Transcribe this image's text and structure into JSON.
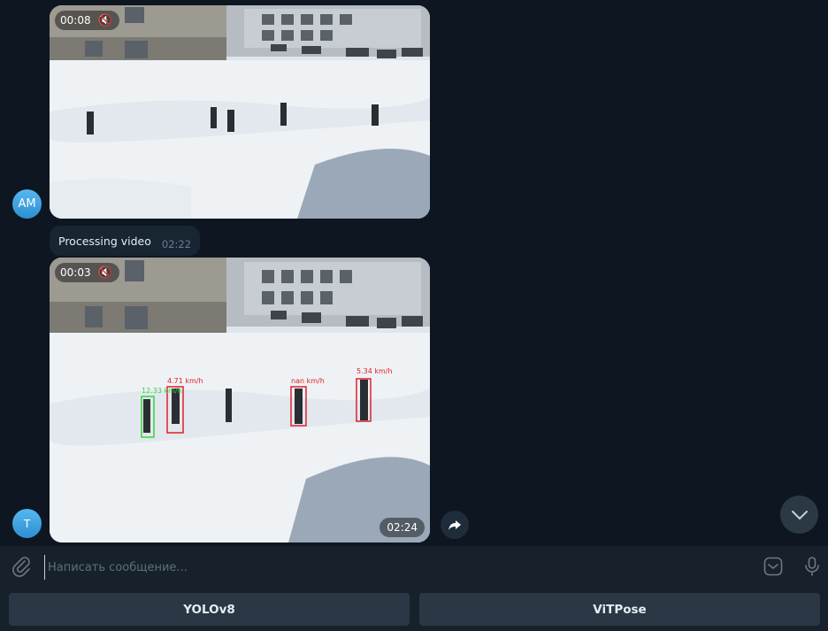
{
  "messages": [
    {
      "avatar": "AM",
      "video": {
        "duration": "00:08",
        "muted": true
      }
    },
    {
      "text": "Processing video",
      "time": "02:22"
    },
    {
      "avatar": "T",
      "video": {
        "duration": "00:03",
        "muted": true,
        "time": "02:24",
        "detections": [
          "12.33 km/h",
          "4.71 km/h",
          "nan km/h",
          "5.34 km/h"
        ]
      }
    }
  ],
  "composer": {
    "placeholder": "Написать сообщение..."
  },
  "keyboard": {
    "buttons": [
      "YOLOv8",
      "ViTPose"
    ]
  },
  "icons": {
    "mute": "speaker-muted-icon",
    "share": "share-arrow-icon",
    "scroll": "chevron-down-icon",
    "attach": "paperclip-icon",
    "emoji": "sticker-icon",
    "mic": "microphone-icon"
  },
  "colors": {
    "background": "#0e1621",
    "bubble": "#182533",
    "panel": "#17212b",
    "button": "#2b3745",
    "avatar": "#3fa3e4",
    "box_green": "#35d43a",
    "box_red": "#e0202a"
  }
}
